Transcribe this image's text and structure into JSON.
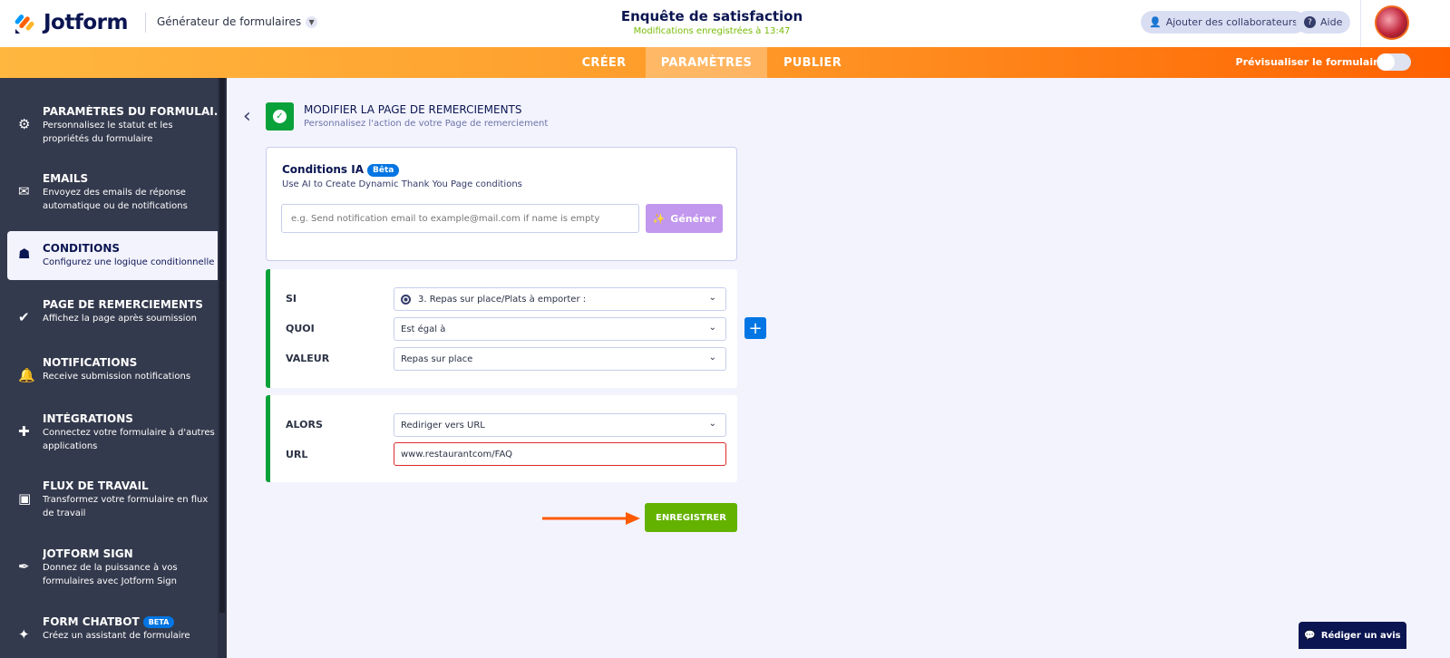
{
  "header": {
    "brand": "Jotform",
    "builder": "Générateur de formulaires",
    "form_title": "Enquête de satisfaction",
    "saved_status": "Modifications enregistrées à 13:47",
    "collaborators": "Ajouter des collaborateurs",
    "help": "Aide"
  },
  "nav": {
    "tabs": [
      {
        "label": "CRÉER"
      },
      {
        "label": "PARAMÈTRES"
      },
      {
        "label": "PUBLIER"
      }
    ],
    "preview": "Prévisualiser le formulaire"
  },
  "sidebar": {
    "items": [
      {
        "title": "PARAMÈTRES DU FORMULAI...",
        "desc": "Personnalisez le statut et les propriétés du formulaire"
      },
      {
        "title": "EMAILS",
        "desc": "Envoyez des emails de réponse automatique ou de notifications"
      },
      {
        "title": "CONDITIONS",
        "desc": "Configurez une logique conditionnelle"
      },
      {
        "title": "PAGE DE REMERCIEMENTS",
        "desc": "Affichez la page après soumission"
      },
      {
        "title": "NOTIFICATIONS",
        "desc": "Receive submission notifications"
      },
      {
        "title": "INTÉGRATIONS",
        "desc": "Connectez votre formulaire à d'autres applications"
      },
      {
        "title": "FLUX DE TRAVAIL",
        "desc": "Transformez votre formulaire en flux de travail"
      },
      {
        "title": "JOTFORM SIGN",
        "desc": "Donnez de la puissance à vos formulaires avec Jotform Sign"
      },
      {
        "title": "FORM CHATBOT",
        "badge": "BETA",
        "desc": "Créez un assistant de formulaire"
      }
    ]
  },
  "page": {
    "title": "MODIFIER LA PAGE DE REMERCIEMENTS",
    "subtitle": "Personnalisez l'action de votre Page de remerciement"
  },
  "ai": {
    "title": "Conditions IA",
    "badge": "Bêta",
    "desc": "Use AI to Create Dynamic Thank You Page conditions",
    "placeholder": "e.g. Send notification email to example@mail.com if name is empty",
    "generate": "Générer"
  },
  "condition": {
    "if_label": "SI",
    "if_value": "3. Repas sur place/Plats à emporter :",
    "what_label": "QUOI",
    "what_value": "Est égal à",
    "value_label": "VALEUR",
    "value_value": "Repas sur place"
  },
  "action": {
    "then_label": "ALORS",
    "then_value": "Rediriger vers URL",
    "url_label": "URL",
    "url_value": "www.restaurantcom/FAQ"
  },
  "save": "ENREGISTRER",
  "review": "Rédiger un avis"
}
